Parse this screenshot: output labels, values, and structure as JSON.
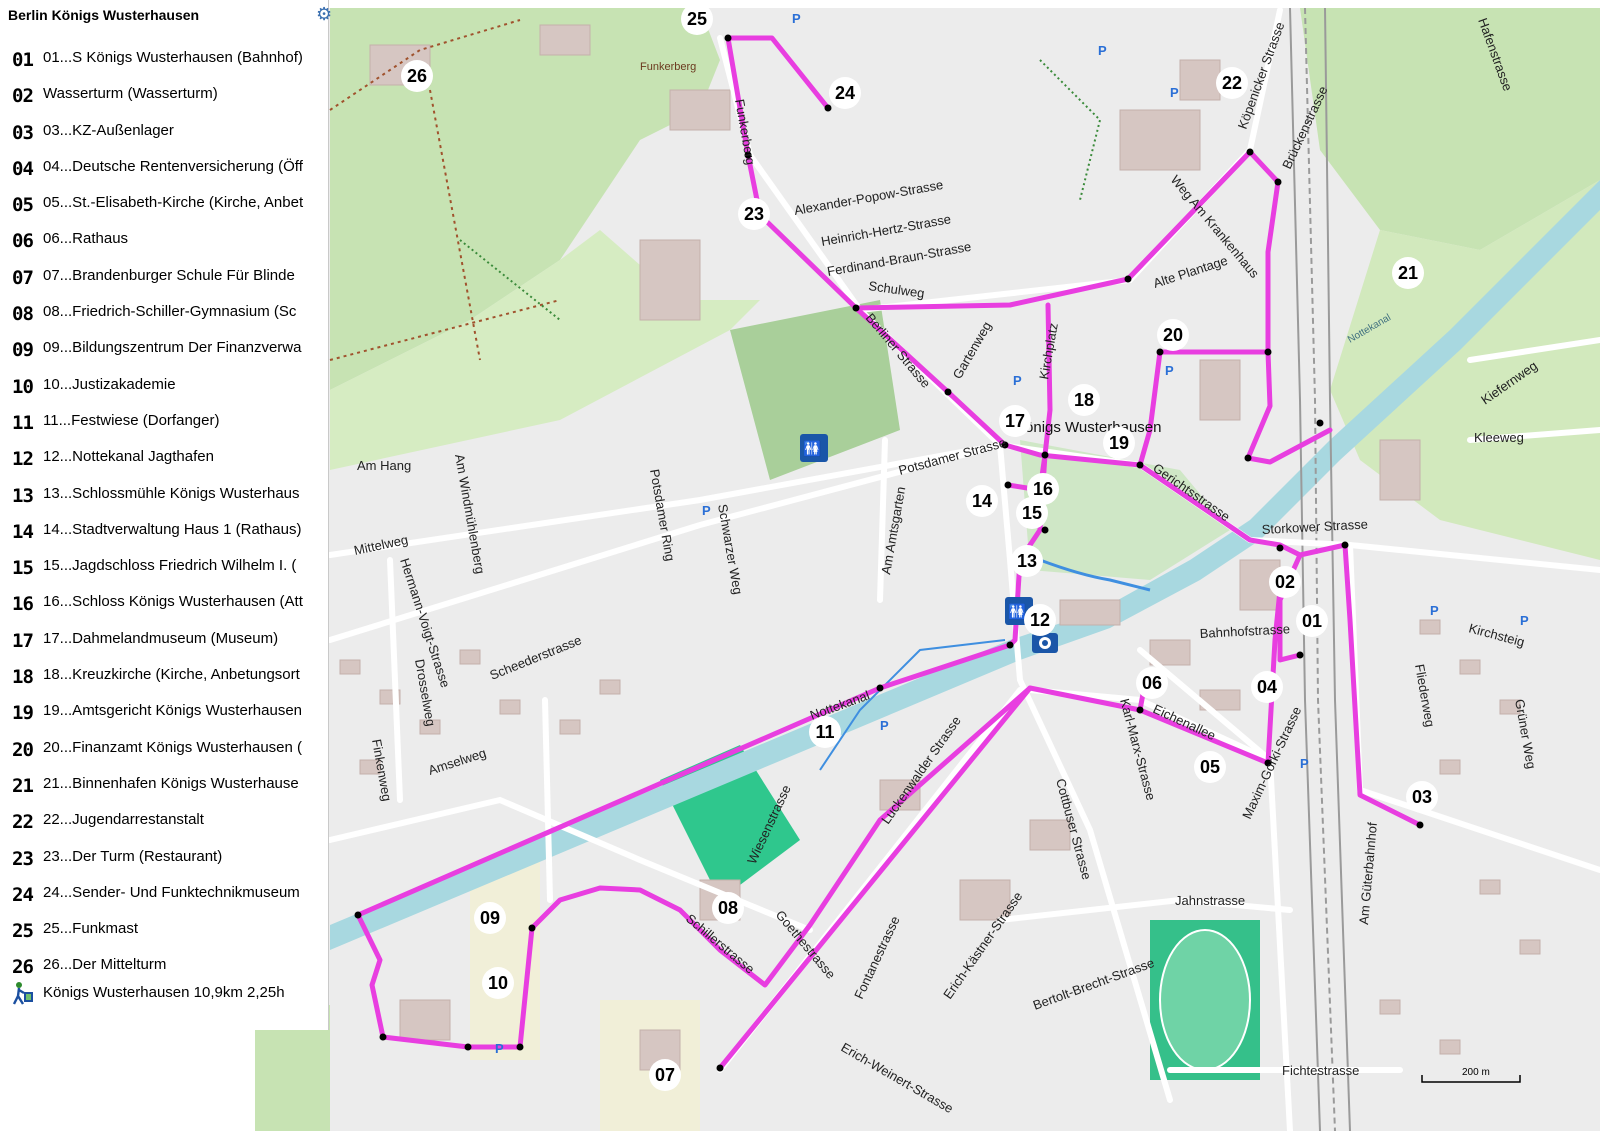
{
  "sidebar": {
    "title": "Berlin Königs Wusterhausen",
    "items": [
      {
        "num": "01",
        "label": "01...S Königs Wusterhausen (Bahnhof)"
      },
      {
        "num": "02",
        "label": "Wasserturm (Wasserturm)"
      },
      {
        "num": "03",
        "label": "03...KZ-Außenlager"
      },
      {
        "num": "04",
        "label": "04...Deutsche Rentenversicherung (Öff"
      },
      {
        "num": "05",
        "label": "05...St.-Elisabeth-Kirche (Kirche, Anbet"
      },
      {
        "num": "06",
        "label": "06...Rathaus"
      },
      {
        "num": "07",
        "label": "07...Brandenburger Schule Für Blinde"
      },
      {
        "num": "08",
        "label": "08...Friedrich-Schiller-Gymnasium (Sc"
      },
      {
        "num": "09",
        "label": "09...Bildungszentrum Der Finanzverwa"
      },
      {
        "num": "10",
        "label": "10...Justizakademie"
      },
      {
        "num": "11",
        "label": "11...Festwiese (Dorfanger)"
      },
      {
        "num": "12",
        "label": "12...Nottekanal Jagthafen"
      },
      {
        "num": "13",
        "label": "13...Schlossmühle Königs Wusterhaus"
      },
      {
        "num": "14",
        "label": "14...Stadtverwaltung Haus 1 (Rathaus)"
      },
      {
        "num": "15",
        "label": "15...Jagdschloss Friedrich Wilhelm I. ("
      },
      {
        "num": "16",
        "label": "16...Schloss Königs Wusterhausen (Att"
      },
      {
        "num": "17",
        "label": "17...Dahmelandmuseum (Museum)"
      },
      {
        "num": "18",
        "label": "18...Kreuzkirche (Kirche, Anbetungsort"
      },
      {
        "num": "19",
        "label": "19...Amtsgericht Königs Wusterhausen"
      },
      {
        "num": "20",
        "label": "20...Finanzamt Königs Wusterhausen ("
      },
      {
        "num": "21",
        "label": "21...Binnenhafen Königs Wusterhause"
      },
      {
        "num": "22",
        "label": "22...Jugendarrestanstalt"
      },
      {
        "num": "23",
        "label": "23...Der Turm (Restaurant)"
      },
      {
        "num": "24",
        "label": "24...Sender- Und Funktechnikmuseum"
      },
      {
        "num": "25",
        "label": "25...Funkmast"
      },
      {
        "num": "26",
        "label": "26...Der Mittelturm"
      }
    ],
    "summary": "Königs Wusterhausen 10,9km 2,25h",
    "summary_icon": "hiker-route-icon",
    "gear_icon": "gear-icon"
  },
  "map": {
    "town_label": "Königs Wusterhausen",
    "scale_label": "200 m",
    "route_color": "#e83ee0",
    "water_color": "#a8d8e0",
    "forest_color": "#b9dca4",
    "streets": [
      "Alexander-Popow-Strasse",
      "Heinrich-Hertz-Strasse",
      "Ferdinand-Braun-Strasse",
      "Schulweg",
      "Berliner Strasse",
      "Gartenweg",
      "Kirchplatz",
      "Alte Plantage",
      "Weg Am Krankenhaus",
      "Köpenicker Strasse",
      "Brückenstrasse",
      "Maxim-Gorki-Strasse",
      "Potsdamer Strasse",
      "Am Hang",
      "Am Windmühlenberg",
      "Potsdamer Ring",
      "Schwarzer Weg",
      "Am Amtsgarten",
      "Mittelweg",
      "Hermann-Voigt-Strasse",
      "Scheederstrasse",
      "Drosselweg",
      "Amselweg",
      "Finkenweg",
      "Gerichtsstrasse",
      "Storkower Strasse",
      "Bahnhofstrasse",
      "Kirchsteig",
      "Fliederweg",
      "Kleeweg",
      "Kiefernweg",
      "Grüner Weg",
      "Am Güterbahnhof",
      "Eichenallee",
      "Karl-Marx-Strasse",
      "Cottbuser Strasse",
      "Luckenwalder Strasse",
      "Wiesenstrasse",
      "Goethestrasse",
      "Schillerstrasse",
      "Jahnstrasse",
      "Erich-Kästner-Strasse",
      "Fontanestrasse",
      "Bertolt-Brecht-Strasse",
      "Erich-Weinert-Strasse",
      "Fichtestrasse",
      "Funkerberg",
      "Nottekanal",
      "Hafenstrasse"
    ],
    "place_labels": [
      "Funkerberg",
      "Nottekanal"
    ],
    "waypoints": [
      "01",
      "02",
      "03",
      "04",
      "05",
      "06",
      "07",
      "08",
      "09",
      "10",
      "11",
      "12",
      "13",
      "14",
      "15",
      "16",
      "17",
      "18",
      "19",
      "20",
      "21",
      "22",
      "23",
      "24",
      "25",
      "26"
    ]
  }
}
